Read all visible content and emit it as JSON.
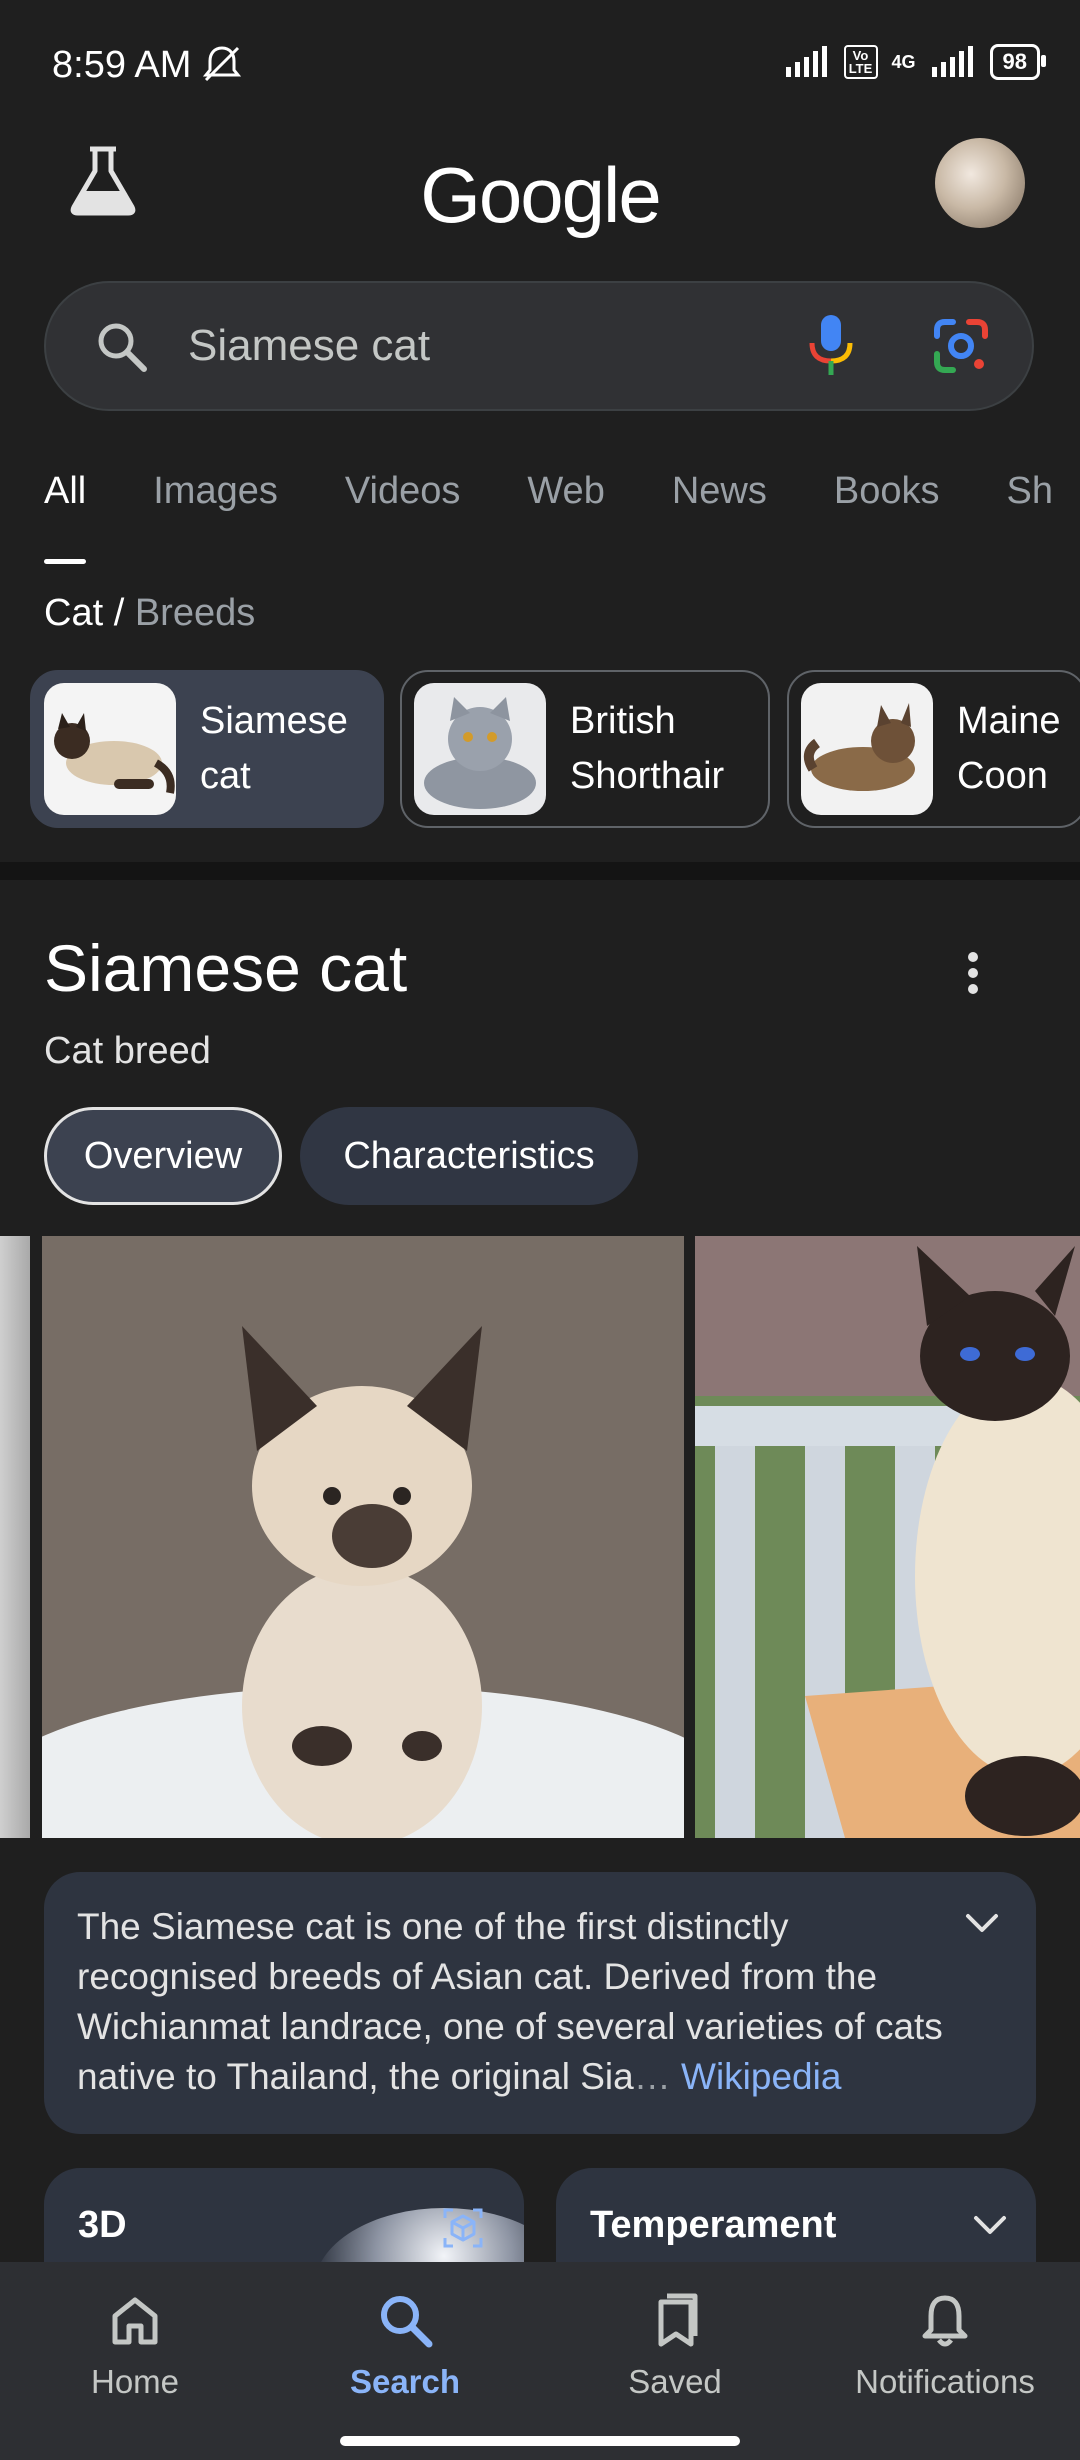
{
  "status_bar": {
    "time": "8:59 AM",
    "network": "4G",
    "volte": "Vo LTE",
    "battery": "98"
  },
  "header": {
    "logo": "Google"
  },
  "search": {
    "query": "Siamese cat"
  },
  "tabs": [
    "All",
    "Images",
    "Videos",
    "Web",
    "News",
    "Books",
    "Sh"
  ],
  "breadcrumb": {
    "parent": "Cat",
    "separator": "/",
    "current": "Breeds"
  },
  "breeds": [
    {
      "line1": "Siamese",
      "line2": "cat"
    },
    {
      "line1": "British",
      "line2": "Shorthair"
    },
    {
      "line1": "Maine",
      "line2": "Coon"
    }
  ],
  "knowledge_panel": {
    "title": "Siamese cat",
    "subtitle": "Cat breed",
    "pills": [
      "Overview",
      "Characteristics"
    ],
    "description": "The Siamese cat is one of the first distinctly recognised breeds of Asian cat. Derived from the Wichianmat landrace, one of several varieties of cats native to Thailand, the original Sia",
    "ellipsis": "…",
    "source": "Wikipedia",
    "cards": [
      "3D",
      "Temperament"
    ]
  },
  "bottom_nav": [
    "Home",
    "Search",
    "Saved",
    "Notifications"
  ],
  "colors": {
    "background": "#1f1f1f",
    "accent": "#8ab4f8",
    "card": "#2e3440"
  }
}
